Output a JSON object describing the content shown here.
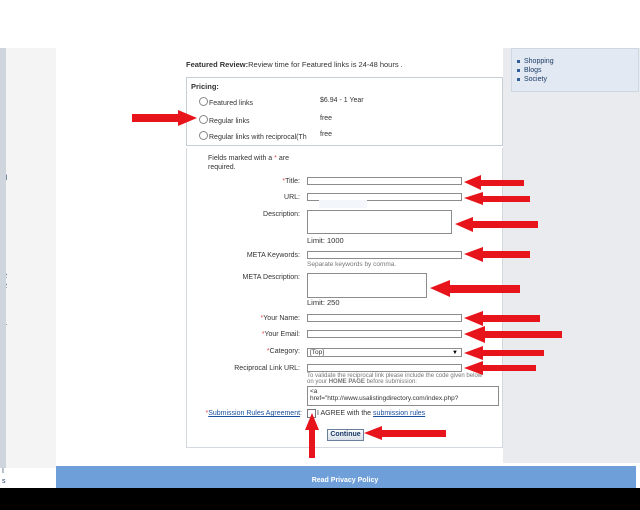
{
  "featured_review": {
    "label": "Featured Review:",
    "text": "Review time for Featured links is 24-48 hours ."
  },
  "pricing": {
    "title": "Pricing:",
    "options": [
      {
        "label": "Featured links",
        "price": "$6.94 - 1 Year"
      },
      {
        "label": "Regular links",
        "price": "free"
      },
      {
        "label": "Regular links with reciprocal(Th",
        "price": "free"
      }
    ]
  },
  "required_note": {
    "prefix": "Fields marked with a",
    "star": "*",
    "suffix": "are required."
  },
  "fields": {
    "title": {
      "star": "*",
      "label": "Title:"
    },
    "url": {
      "label": "URL:"
    },
    "description": {
      "label": "Description:",
      "limit": "Limit: 1000"
    },
    "meta_keywords": {
      "label": "META Keywords:",
      "hint": "Separate keywords by comma."
    },
    "meta_description": {
      "label": "META Description:",
      "limit": "Limit: 250"
    },
    "your_name": {
      "star": "*",
      "label": "Your Name:"
    },
    "your_email": {
      "star": "*",
      "label": "Your Email:"
    },
    "category": {
      "star": "*",
      "label": "Category:",
      "value": "[Top]"
    },
    "reciprocal": {
      "label": "Reciprocal Link URL:",
      "hint_line1": "To validate the reciprocal link please include the code given below",
      "hint_line2_pre": "on your",
      "hint_line2_bold": "HOME PAGE",
      "hint_line2_post": "before submission:",
      "code_line1": "<a",
      "code_line2": "href=\"http://www.usalistingdirectory.com/index.php?"
    },
    "rules": {
      "star": "*",
      "label": "Submission Rules Agreement",
      "colon": ":"
    },
    "agree": {
      "prefix": "I AGREE with the",
      "link": "submission rules"
    }
  },
  "continue_label": "Continue",
  "sidebar_categories": [
    "Shopping",
    "Blogs",
    "Society"
  ],
  "footer": {
    "link": "Read Privacy Policy"
  },
  "left_fragments": [
    "t",
    "t",
    "sl",
    "t",
    "t",
    "R",
    "R",
    "t",
    "Pr",
    "I",
    "c",
    "I",
    "s"
  ],
  "colors": {
    "arrow": "#e8141b",
    "footer": "#6f9fd8",
    "accent_star": "#d9534f"
  }
}
